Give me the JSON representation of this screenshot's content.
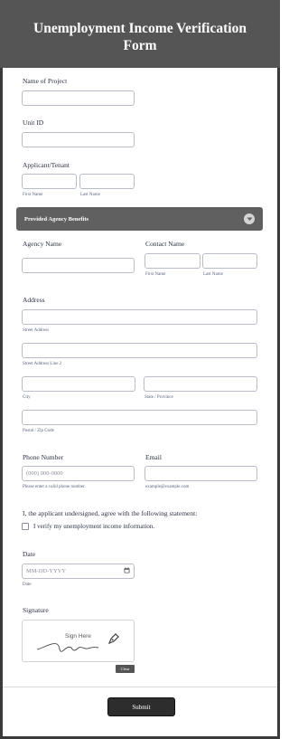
{
  "form": {
    "title": "Unemployment Income Verification Form",
    "project": {
      "label": "Name of Project",
      "value": ""
    },
    "unit": {
      "label": "Unit ID",
      "value": ""
    },
    "applicant": {
      "label": "Applicant/Tenant",
      "first_sub": "First Name",
      "last_sub": "Last Name"
    },
    "section": {
      "title": "Provided Agency Benefits"
    },
    "agency": {
      "label": "Agency Name"
    },
    "contact": {
      "label": "Contact Name",
      "first_sub": "First Name",
      "last_sub": "Last Name"
    },
    "address": {
      "label": "Address",
      "street_sub": "Street Address",
      "street2_sub": "Street Address Line 2",
      "city_sub": "City",
      "state_sub": "State / Province",
      "postal_sub": "Postal / Zip Code"
    },
    "phone": {
      "label": "Phone Number",
      "placeholder": "(000) 000-0000",
      "sub": "Please enter a valid phone number."
    },
    "email": {
      "label": "Email",
      "sub": "example@example.com"
    },
    "statement": {
      "text": "I, the applicant undersigned, agree with the following statement:",
      "checkbox_label": "I verify my unemployment income information.",
      "checked": false
    },
    "date": {
      "label": "Date",
      "placeholder": "MM-DD-YYYY",
      "sub": "Date"
    },
    "signature": {
      "label": "Signature",
      "hint": "Sign Here",
      "clear_label": "Clear"
    },
    "submit_label": "Submit"
  },
  "colors": {
    "header_bg": "#555555",
    "section_bg": "#606060",
    "submit_bg": "#2d2d2d"
  }
}
